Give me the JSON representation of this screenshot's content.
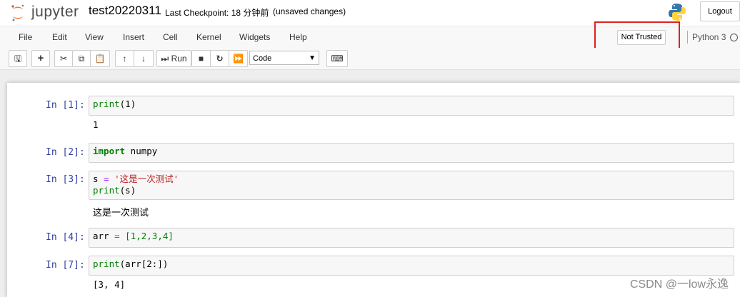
{
  "header": {
    "logo_text": "jupyter",
    "notebook_name": "test20220311",
    "checkpoint": "Last Checkpoint: 18 分钟前",
    "unsaved": "(unsaved changes)",
    "logout_label": "Logout"
  },
  "menubar": {
    "items": [
      "File",
      "Edit",
      "View",
      "Insert",
      "Cell",
      "Kernel",
      "Widgets",
      "Help"
    ],
    "trust_label": "Not Trusted",
    "kernel_name": "Python 3"
  },
  "toolbar": {
    "run_label": "Run",
    "cell_type": "Code",
    "icons": [
      "save-icon",
      "plus-icon",
      "cut-icon",
      "copy-icon",
      "paste-icon",
      "arrow-up-icon",
      "arrow-down-icon",
      "run-icon",
      "stop-icon",
      "restart-icon",
      "fast-forward-icon",
      "keyboard-icon"
    ]
  },
  "cells": [
    {
      "prompt": "In  [1]:",
      "output": "1"
    },
    {
      "prompt": "In  [2]:",
      "output": ""
    },
    {
      "prompt": "In  [3]:",
      "output": "这是一次测试"
    },
    {
      "prompt": "In  [4]:",
      "output": ""
    },
    {
      "prompt": "In  [7]:",
      "output": "[3, 4]"
    }
  ],
  "code": {
    "c1_fn": "print",
    "c1_rest": "(1)",
    "c2_kw": "import",
    "c2_rest": " numpy",
    "c3_var": "s ",
    "c3_eq": "=",
    "c3_str": " '这是一次测试'",
    "c3_fn": "print",
    "c3_rest": "(s)",
    "c4_var": "arr ",
    "c4_eq": "=",
    "c4_list": " [1,2,3,4]",
    "c5_fn": "print",
    "c5_rest": "(arr[2:])"
  },
  "watermark": "CSDN @一low永逸",
  "colors": {
    "prompt": "#303f9f",
    "keyword": "#008000",
    "string": "#ba2121",
    "highlight": "#e02020"
  }
}
